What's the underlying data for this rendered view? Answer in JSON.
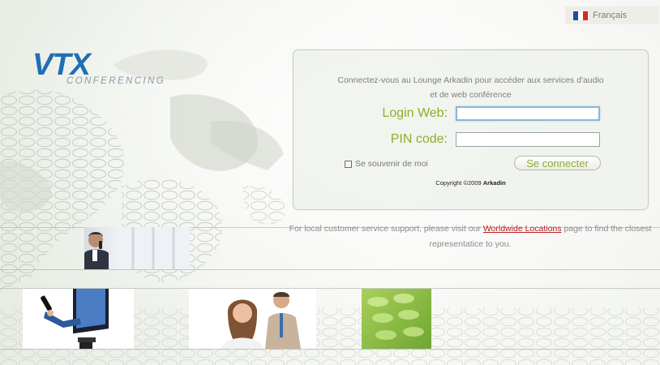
{
  "language": {
    "label": "Français",
    "flag_colors": [
      "#1f49a6",
      "#ffffff",
      "#d62a2a"
    ]
  },
  "brand": {
    "logo_text": "VTX",
    "sub_text": "CONFERENCING",
    "logo_color": "#1e6fb3"
  },
  "login": {
    "intro_line1": "Connectez-vous au Lounge Arkadin pour accéder aux services d'audio",
    "intro_line2": "et de web conférence",
    "login_label": "Login Web:",
    "login_value": "",
    "pin_label": "PIN code:",
    "pin_value": "",
    "remember_label": "Se souvenir de moi",
    "remember_checked": false,
    "submit_label": "Se connecter",
    "copyright_prefix": "Copyright ©2009 ",
    "copyright_brand": "Arkadin",
    "label_color": "#8fae2b"
  },
  "support": {
    "text_before": "For local customer service support, please visit our ",
    "link_text": "Worldwide Locations",
    "text_after": " page to find the closest representatice to you.",
    "link_color": "#b21f1f"
  }
}
